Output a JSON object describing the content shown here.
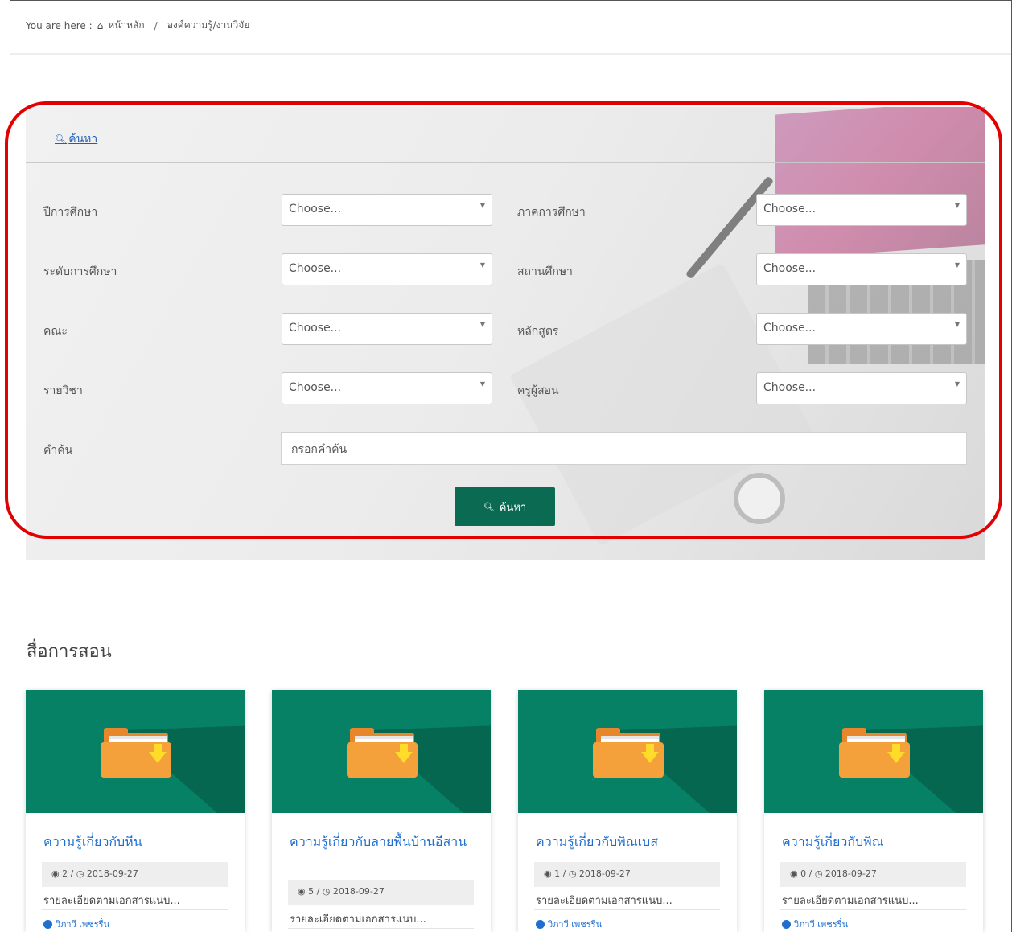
{
  "breadcrumb": {
    "prefix": "You are here :",
    "home_icon": "home-icon",
    "home": "หน้าหลัก",
    "separator": "/",
    "current": "องค์ความรู้/งานวิจัย"
  },
  "search_panel": {
    "header_link": "ค้นหา",
    "fields": [
      {
        "label": "ปีการศึกษา",
        "value": "Choose..."
      },
      {
        "label": "ภาคการศึกษา",
        "value": "Choose..."
      },
      {
        "label": "ระดับการศึกษา",
        "value": "Choose..."
      },
      {
        "label": "สถานศึกษา",
        "value": "Choose..."
      },
      {
        "label": "คณะ",
        "value": "Choose..."
      },
      {
        "label": "หลักสูตร",
        "value": "Choose..."
      },
      {
        "label": "รายวิชา",
        "value": "Choose..."
      },
      {
        "label": "ครูผู้สอน",
        "value": "Choose..."
      }
    ],
    "keyword_label": "คำค้น",
    "keyword_placeholder": "กรอกคำค้น",
    "submit_label": "ค้นหา",
    "highlight_color": "#e30000",
    "button_color": "#0a6b52"
  },
  "section": {
    "title": "สื่อการสอน"
  },
  "cards": [
    {
      "title": "ความรู้เกี่ยวกับหีน",
      "views": "2",
      "date": "2018-09-27",
      "description": "รายละเอียดตามเอกสารแนบ...",
      "author": "วิภาวี เพชรรื่น"
    },
    {
      "title": "ความรู้เกี่ยวกับลายพื้นบ้านอีสาน",
      "views": "5",
      "date": "2018-09-27",
      "description": "รายละเอียดตามเอกสารแนบ...",
      "author": "วิภาวี เพชรรื่น"
    },
    {
      "title": "ความรู้เกี่ยวกับพิณเบส",
      "views": "1",
      "date": "2018-09-27",
      "description": "รายละเอียดตามเอกสารแนบ...",
      "author": "วิภาวี เพชรรื่น"
    },
    {
      "title": "ความรู้เกี่ยวกับพิณ",
      "views": "0",
      "date": "2018-09-27",
      "description": "รายละเอียดตามเอกสารแนบ...",
      "author": "วิภาวี เพชรรื่น"
    }
  ],
  "colors": {
    "card_thumb": "#078166",
    "link": "#1e6fcf"
  }
}
